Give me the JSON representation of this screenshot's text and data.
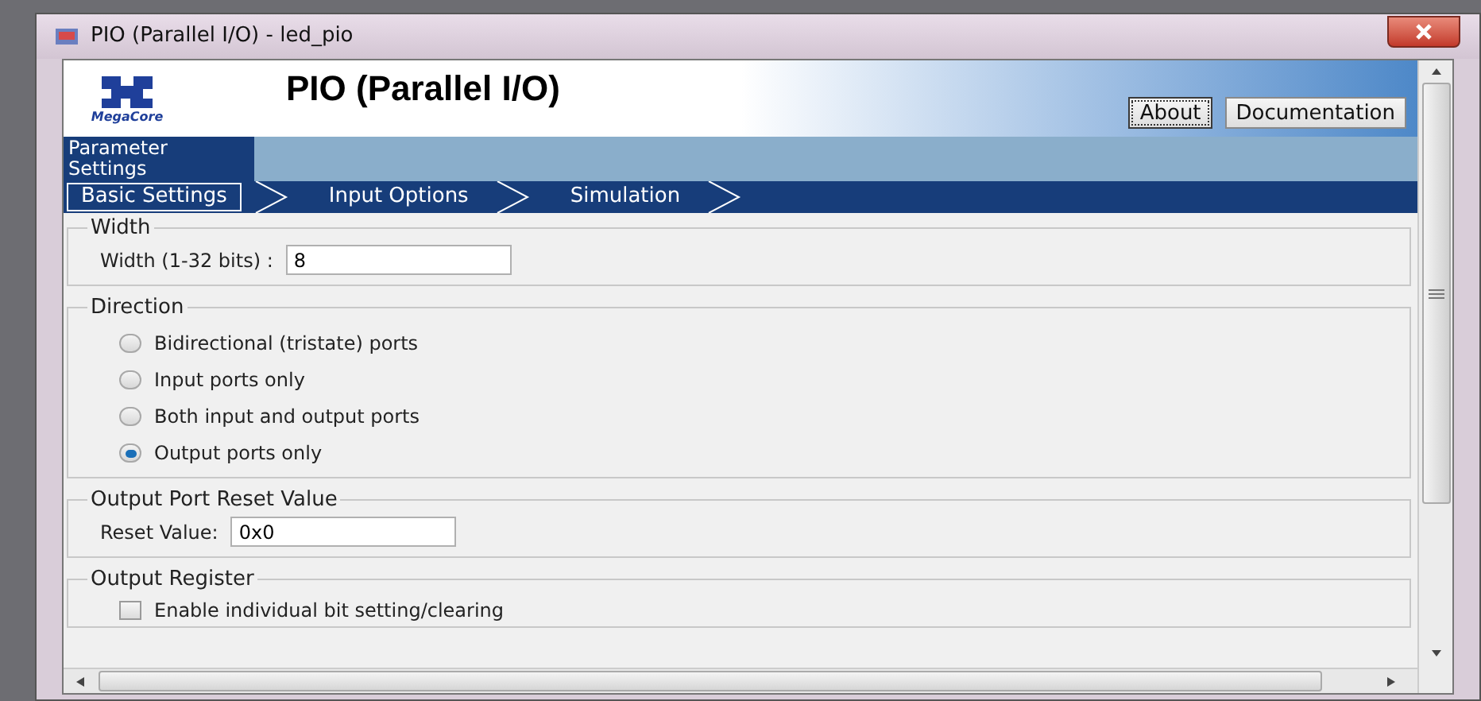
{
  "window": {
    "title": "PIO (Parallel I/O) - led_pio"
  },
  "header": {
    "title": "PIO (Parallel I/O)",
    "logo_text": "MegaCore",
    "buttons": [
      {
        "label": "About",
        "focused": true
      },
      {
        "label": "Documentation",
        "focused": false
      }
    ]
  },
  "tabs": [
    {
      "label": "Parameter Settings",
      "selected": true
    }
  ],
  "steps": [
    {
      "label": "Basic Settings",
      "selected": true
    },
    {
      "label": "Input Options",
      "selected": false
    },
    {
      "label": "Simulation",
      "selected": false
    }
  ],
  "groups": [
    {
      "kind": "field",
      "title": "Width",
      "label": "Width (1-32 bits) :",
      "value": "8"
    },
    {
      "kind": "radios",
      "title": "Direction",
      "options": [
        {
          "label": "Bidirectional (tristate) ports",
          "selected": false
        },
        {
          "label": "Input ports only",
          "selected": false
        },
        {
          "label": "Both input and output ports",
          "selected": false
        },
        {
          "label": "Output ports only",
          "selected": true
        }
      ]
    },
    {
      "kind": "field",
      "title": "Output Port Reset Value",
      "label": "Reset Value:",
      "value": "0x0"
    },
    {
      "kind": "checkbox",
      "title": "Output Register",
      "label": "Enable individual bit setting/clearing",
      "checked": false
    }
  ]
}
